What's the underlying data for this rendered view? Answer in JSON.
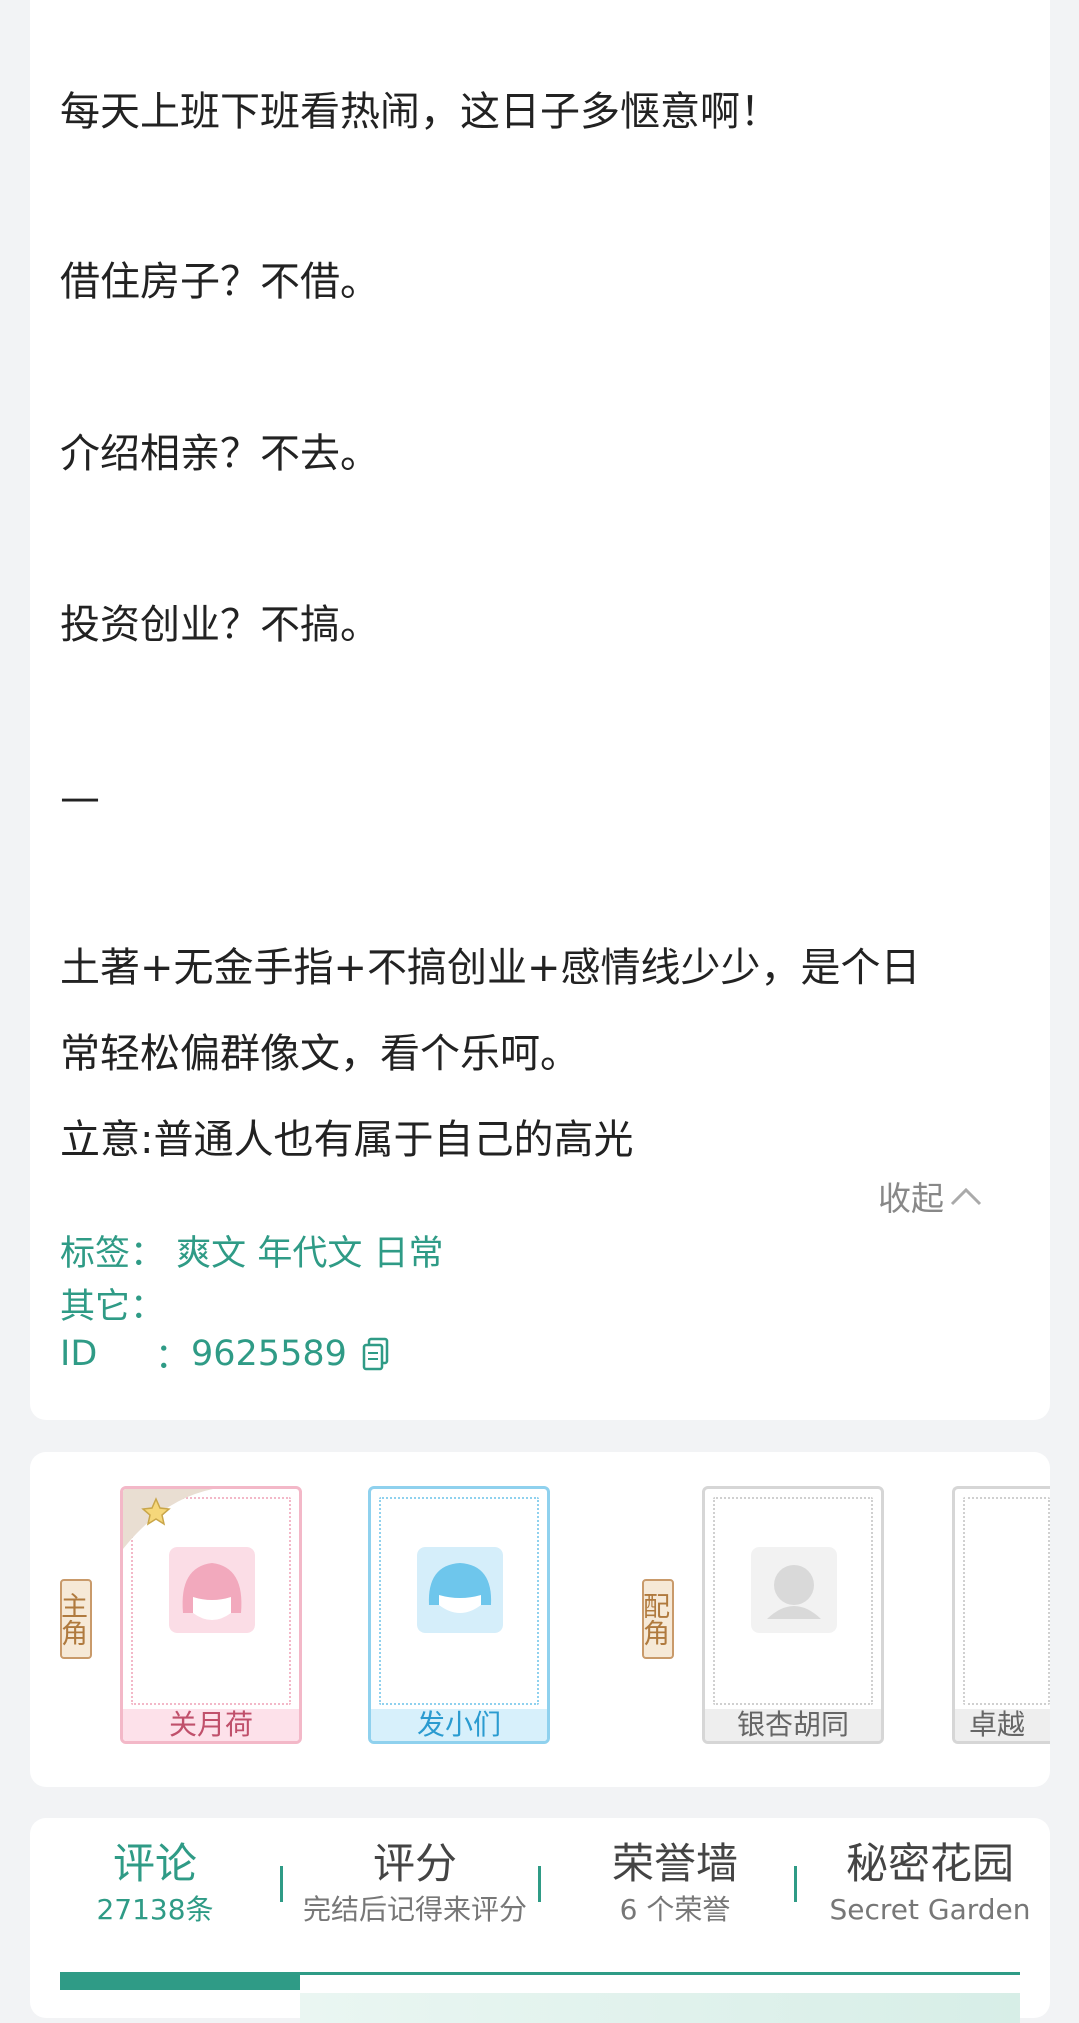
{
  "intro": {
    "paragraphs": [
      "每天上班下班看热闹，这日子多惬意啊！",
      "借住房子？不借。",
      "介绍相亲？不去。",
      "投资创业？不搞。",
      "—",
      "土著+无金手指+不搞创业+感情线少少，是个日",
      "常轻松偏群像文，看个乐呵。",
      "立意:普通人也有属于自己的高光"
    ],
    "collapse_label": "收起"
  },
  "meta": {
    "tags_label": "标签：",
    "tags": [
      "爽文",
      "年代文",
      "日常"
    ],
    "other_label": "其它：",
    "id_label": "ID",
    "id_colon": "：",
    "id_value": "9625589"
  },
  "roles": {
    "main_tag": "主角",
    "support_tag": "配角",
    "main": [
      "关月荷",
      "发小们"
    ],
    "supporting": [
      "银杏胡同",
      "卓越"
    ]
  },
  "tabs": [
    {
      "title": "评论",
      "sub": "27138条"
    },
    {
      "title": "评分",
      "sub": "完结后记得来评分"
    },
    {
      "title": "荣誉墙",
      "sub": "6 个荣誉"
    },
    {
      "title": "秘密花园",
      "sub": "Secret Garden"
    }
  ],
  "colors": {
    "accent": "#2f9b86",
    "pink": "#f3b8c8",
    "blue": "#8fd1ee"
  }
}
